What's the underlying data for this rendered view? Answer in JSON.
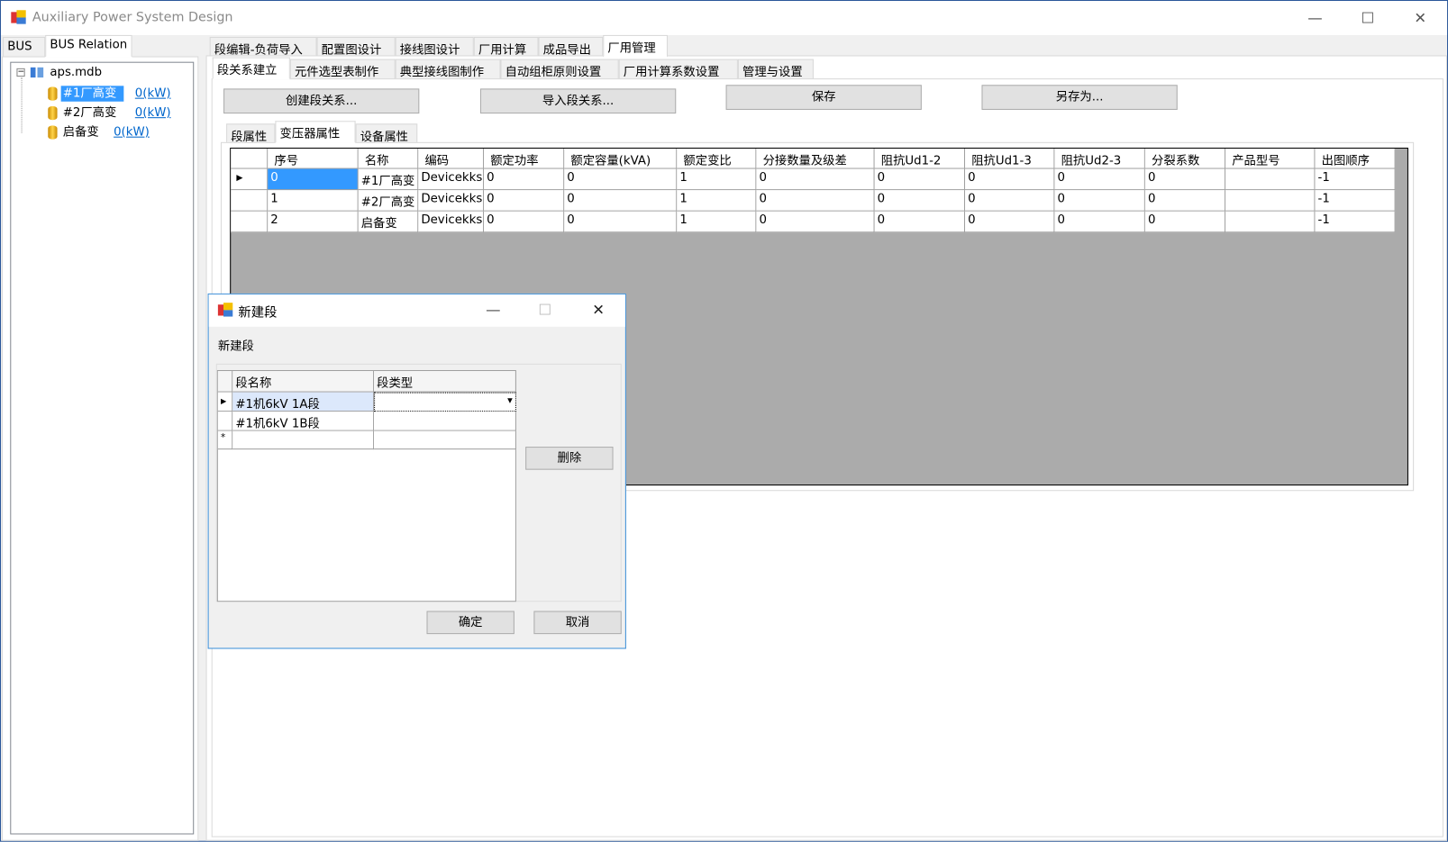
{
  "window": {
    "title": "Auxiliary Power System Design",
    "minimize": "—",
    "maximize": "☐",
    "close": "✕"
  },
  "left_tabs": [
    "BUS",
    "BUS Relation"
  ],
  "tree": {
    "root": "aps.mdb",
    "collapse": "−",
    "items": [
      {
        "label": "#1厂高变",
        "load": "0(kW)"
      },
      {
        "label": "#2厂高变",
        "load": "0(kW)"
      },
      {
        "label": "启备变",
        "load": "0(kW)"
      }
    ]
  },
  "main_tabs": [
    "段编辑-负荷导入",
    "配置图设计",
    "接线图设计",
    "厂用计算",
    "成品导出",
    "厂用管理"
  ],
  "sub_tabs": [
    "段关系建立",
    "元件选型表制作",
    "典型接线图制作",
    "自动组柜原则设置",
    "厂用计算系数设置",
    "管理与设置"
  ],
  "buttons": {
    "create": "创建段关系...",
    "import": "导入段关系...",
    "save": "保存",
    "save_as": "另存为..."
  },
  "prop_tabs": [
    "段属性",
    "变压器属性",
    "设备属性"
  ],
  "table": {
    "columns": [
      "序号",
      "名称",
      "编码",
      "额定功率",
      "额定容量(kVA)",
      "额定变比",
      "分接数量及级差",
      "阻抗Ud1-2",
      "阻抗Ud1-3",
      "阻抗Ud2-3",
      "分裂系数",
      "产品型号",
      "出图顺序"
    ],
    "rows": [
      [
        "0",
        "#1厂高变",
        "Devicekks",
        "0",
        "0",
        "1",
        "0",
        "0",
        "0",
        "0",
        "0",
        "",
        "-1"
      ],
      [
        "1",
        "#2厂高变",
        "Devicekks",
        "0",
        "0",
        "1",
        "0",
        "0",
        "0",
        "0",
        "0",
        "",
        "-1"
      ],
      [
        "2",
        "启备变",
        "Devicekks",
        "0",
        "0",
        "1",
        "0",
        "0",
        "0",
        "0",
        "0",
        "",
        "-1"
      ]
    ],
    "current_row_marker": "▶"
  },
  "dialog": {
    "title": "新建段",
    "heading": "新建段",
    "columns": [
      "段名称",
      "段类型"
    ],
    "rows": [
      [
        "#1机6kV 1A段",
        ""
      ],
      [
        "#1机6kV 1B段",
        ""
      ]
    ],
    "new_row_marker": "*",
    "current_row_marker": "▶",
    "dropdown_arrow": "▾",
    "delete": "删除",
    "ok": "确定",
    "cancel": "取消",
    "minimize": "—",
    "maximize": "☐",
    "close": "✕"
  }
}
